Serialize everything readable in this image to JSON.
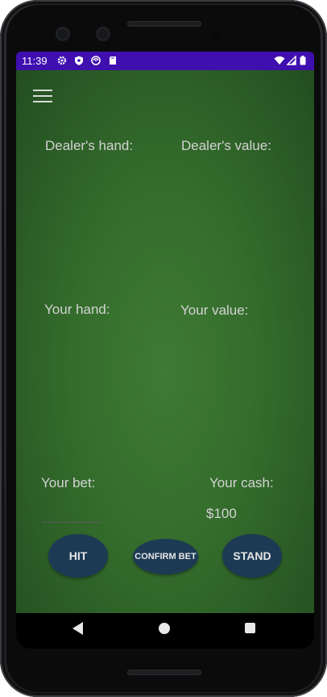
{
  "status_bar": {
    "time": "11:39",
    "icons": [
      "settings-icon",
      "shield-icon",
      "sync-icon",
      "sd-card-icon",
      "wifi-icon",
      "signal-icon",
      "battery-icon"
    ],
    "background": "#3f0fb0"
  },
  "app": {
    "menu_icon": "hamburger-menu-icon",
    "dealer": {
      "hand_label": "Dealer's hand:",
      "value_label": "Dealer's value:"
    },
    "player": {
      "hand_label": "Your hand:",
      "value_label": "Your value:"
    },
    "bet": {
      "label": "Your bet:",
      "value": ""
    },
    "cash": {
      "label": "Your cash:",
      "value": "$100"
    },
    "buttons": {
      "hit": "HIT",
      "confirm_bet": "CONFIRM BET",
      "stand": "STAND"
    },
    "colors": {
      "felt": "#346c2c",
      "button": "#1d3a55",
      "label_text": "#d3d3d3"
    }
  },
  "nav_bar": {
    "icons": [
      "back-icon",
      "home-icon",
      "recents-icon"
    ]
  }
}
